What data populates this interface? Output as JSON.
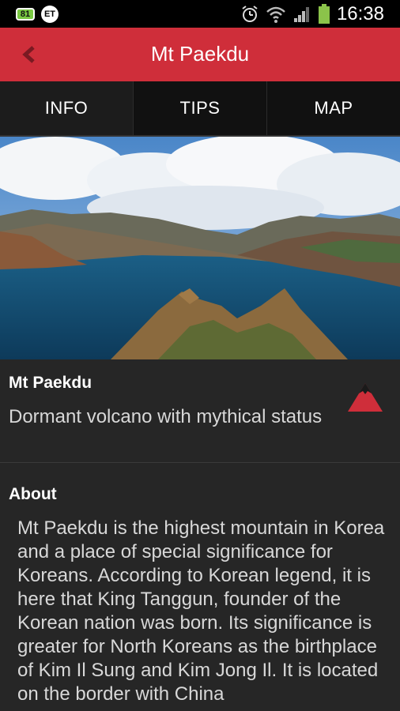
{
  "status_bar": {
    "notification_badge": "81",
    "carrier_badge": "ET",
    "time": "16:38"
  },
  "app_bar": {
    "title": "Mt Paekdu"
  },
  "tabs": [
    {
      "label": "INFO"
    },
    {
      "label": "TIPS"
    },
    {
      "label": "MAP"
    }
  ],
  "place": {
    "name": "Mt Paekdu",
    "subtitle": "Dormant volcano with mythical status"
  },
  "about": {
    "heading": "About",
    "body": "Mt Paekdu is the highest mountain in Korea and a place of special significance for Koreans. According to Korean legend, it is here that King Tanggun, founder of the Korean nation was born. Its significance is greater for North Koreans as the birthplace of Kim Il Sung and Kim Jong Il. It is located on the border with China"
  },
  "colors": {
    "accent": "#cf2e3a",
    "tab_bg": "#111111",
    "content_bg": "#262626"
  },
  "icons": {
    "back": "chevron-left-icon",
    "category": "mountain-icon",
    "alarm": "alarm-clock-icon",
    "wifi": "wifi-icon",
    "signal": "cell-signal-icon",
    "battery": "battery-icon"
  }
}
